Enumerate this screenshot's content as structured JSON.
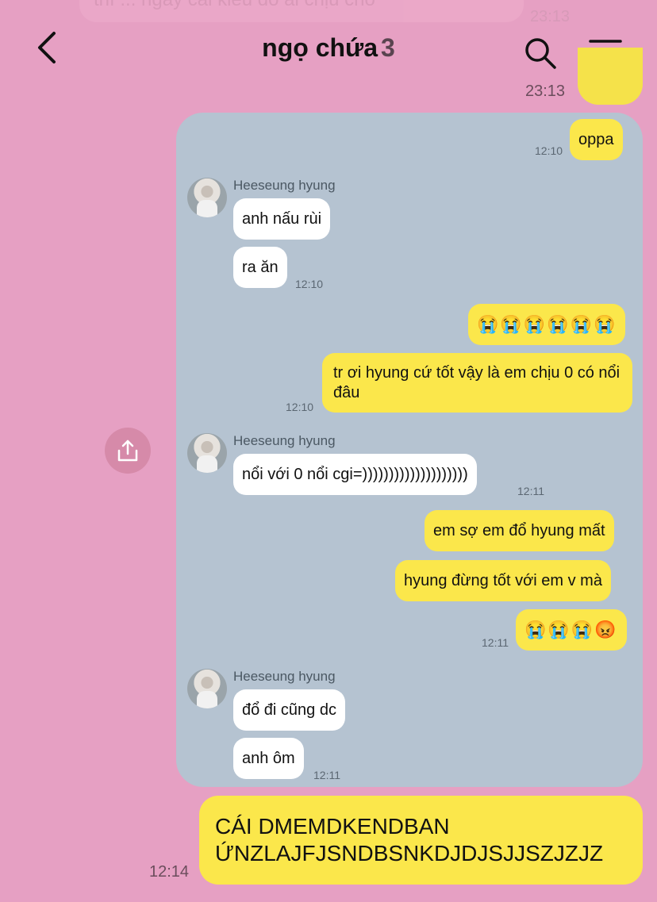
{
  "faded": {
    "text": "thì ... ngày cái kiểu đó ai chịu cho",
    "time": "23:13"
  },
  "header": {
    "title": "ngọ chứa",
    "member_count": "3"
  },
  "previous": {
    "time": "23:13"
  },
  "shared": {
    "messages": [
      {
        "text": "oppa",
        "time": "12:10"
      },
      {
        "sender": "Heeseung hyung",
        "text": "anh nấu rùi"
      },
      {
        "text": "ra ăn",
        "time": "12:10"
      },
      {
        "text": "😭😭😭😭😭😭"
      },
      {
        "text": "tr ơi hyung cứ tốt vậy là em chịu 0 có nổi đâu",
        "time": "12:10"
      },
      {
        "sender": "Heeseung hyung",
        "text": "nổi với 0 nổi cgi=))))))))))))))))))))",
        "time": "12:11"
      },
      {
        "text": "em sợ em đổ hyung mất"
      },
      {
        "text": "hyung đừng tốt với em v mà"
      },
      {
        "text": "😭😭😭😡",
        "time": "12:11"
      },
      {
        "sender": "Heeseung hyung",
        "text": "đổ đi cũng dc"
      },
      {
        "text": "anh ôm",
        "time": "12:11"
      }
    ]
  },
  "final": {
    "text": "CÁI DMEMDKENDBAN ỨNZLAJFJSNDBSNKDJDJSJJSZJZJZ",
    "time": "12:14"
  }
}
